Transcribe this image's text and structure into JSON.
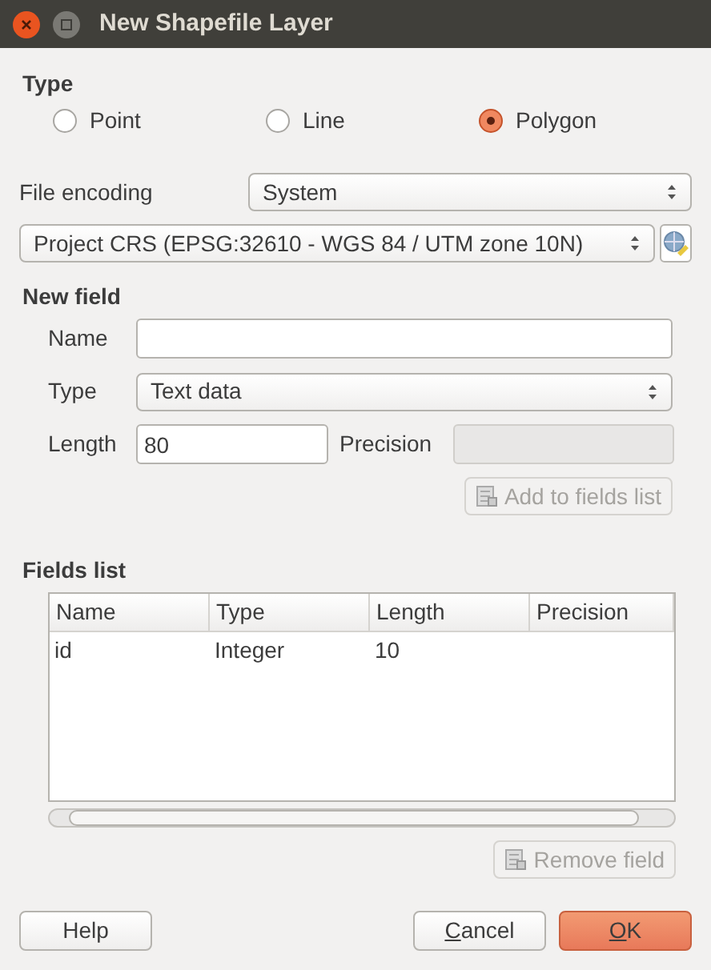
{
  "window": {
    "title": "New Shapefile Layer"
  },
  "type_section": {
    "title": "Type",
    "options": [
      {
        "label": "Point",
        "selected": false
      },
      {
        "label": "Line",
        "selected": false
      },
      {
        "label": "Polygon",
        "selected": true
      }
    ]
  },
  "file_encoding": {
    "label": "File encoding",
    "value": "System"
  },
  "crs": {
    "value": "Project CRS (EPSG:32610 - WGS 84 / UTM zone 10N)"
  },
  "new_field": {
    "title": "New field",
    "name_label": "Name",
    "type_label": "Type",
    "type_value": "Text data",
    "length_label": "Length",
    "length_value": "80",
    "precision_label": "Precision",
    "precision_disabled": true,
    "add_button": {
      "label": "Add to fields list",
      "disabled": true
    }
  },
  "fields_list": {
    "title": "Fields list",
    "columns": [
      "Name",
      "Type",
      "Length",
      "Precision"
    ],
    "rows": [
      [
        "id",
        "Integer",
        "10"
      ]
    ],
    "remove_button": {
      "label": "Remove field",
      "disabled": true
    }
  },
  "buttons": [
    {
      "label": "Help",
      "primary": false,
      "underline_first": false
    },
    {
      "label": "Cancel",
      "primary": false,
      "underline_first": true
    },
    {
      "label": "OK",
      "primary": true,
      "underline_first": true
    }
  ]
}
